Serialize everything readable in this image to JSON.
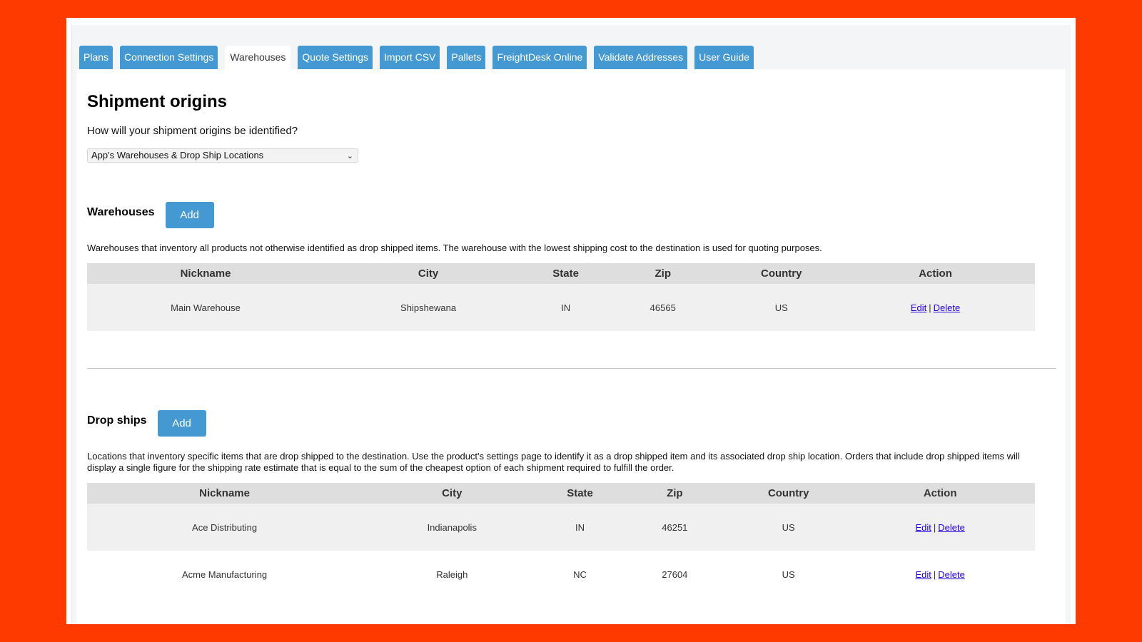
{
  "tabs": [
    {
      "label": "Plans",
      "active": false
    },
    {
      "label": "Connection Settings",
      "active": false
    },
    {
      "label": "Warehouses",
      "active": true
    },
    {
      "label": "Quote Settings",
      "active": false
    },
    {
      "label": "Import CSV",
      "active": false
    },
    {
      "label": "Pallets",
      "active": false
    },
    {
      "label": "FreightDesk Online",
      "active": false
    },
    {
      "label": "Validate Addresses",
      "active": false
    },
    {
      "label": "User Guide",
      "active": false
    }
  ],
  "page": {
    "title": "Shipment origins",
    "question": "How will your shipment origins be identified?",
    "origin_select": {
      "value": "App's Warehouses & Drop Ship Locations",
      "icon": "chevron-down-icon"
    }
  },
  "warehouses": {
    "heading": "Warehouses",
    "add_label": "Add",
    "description": "Warehouses that inventory all products not otherwise identified as drop shipped items. The warehouse with the lowest shipping cost to the destination is used for quoting purposes.",
    "columns": [
      "Nickname",
      "City",
      "State",
      "Zip",
      "Country",
      "Action"
    ],
    "rows": [
      {
        "nickname": "Main Warehouse",
        "city": "Shipshewana",
        "state": "IN",
        "zip": "46565",
        "country": "US",
        "edit": "Edit",
        "sep": "|",
        "delete": "Delete"
      }
    ]
  },
  "dropships": {
    "heading": "Drop ships",
    "add_label": "Add",
    "description": "Locations that inventory specific items that are drop shipped to the destination. Use the product's settings page to identify it as a drop shipped item and its associated drop ship location. Orders that include drop shipped items will display a single figure for the shipping rate estimate that is equal to the sum of the cheapest option of each shipment required to fulfill the order.",
    "columns": [
      "Nickname",
      "City",
      "State",
      "Zip",
      "Country",
      "Action"
    ],
    "rows": [
      {
        "nickname": "Ace Distributing",
        "city": "Indianapolis",
        "state": "IN",
        "zip": "46251",
        "country": "US",
        "edit": "Edit",
        "sep": "|",
        "delete": "Delete"
      },
      {
        "nickname": "Acme Manufacturing",
        "city": "Raleigh",
        "state": "NC",
        "zip": "27604",
        "country": "US",
        "edit": "Edit",
        "sep": "|",
        "delete": "Delete"
      }
    ]
  },
  "colors": {
    "background": "#ff3a00",
    "tab_accent": "#4499d2",
    "link": "#2200dd",
    "table_header": "#dedede",
    "row_alt": "#f0f0f0"
  }
}
